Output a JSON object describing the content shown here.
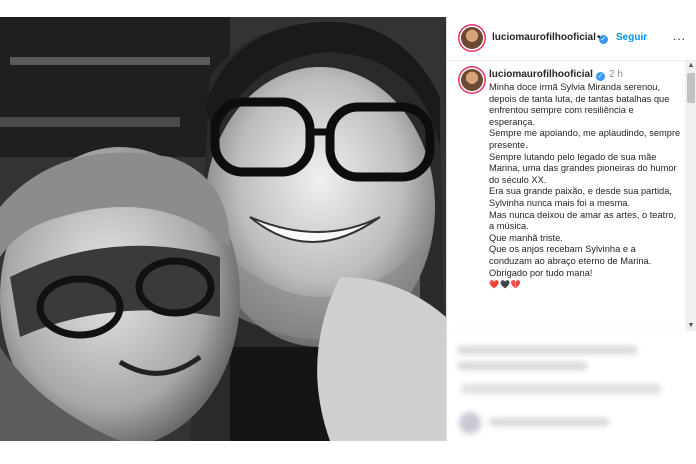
{
  "post": {
    "username": "luciomaurofilhooficial",
    "follow_separator": "•",
    "follow_label": "Seguir",
    "more_label": "...",
    "time": "2 h",
    "verified_icon": "✓",
    "caption_lines": [
      "Minha doce irmã Sylvia Miranda serenou, depois de tanta luta, de tantas batalhas que enfrentou sempre com resiliência e esperança.",
      "Sempre me apoiando, me aplaudindo, sempre presente.",
      "Sempre lutando pelo legado de sua mãe Marina, uma das grandes pioneiras do humor do século XX.",
      "Era sua grande paixão, e desde sua partida, Sylvinha nunca mais foi a mesma.",
      "Mas nunca deixou de amar as artes, o teatro, a música.",
      "Que manhã triste.",
      "Que os anjos recebam Sylvinha e a conduzam ao abraço eterno de Marina.",
      "Obrigado por tudo mana!"
    ],
    "emojis": "❤️🖤💔",
    "scroll_up": "▲",
    "scroll_down": "▼"
  },
  "colors": {
    "link": "#0095f6",
    "verified": "#3897f0",
    "text": "#262626",
    "muted": "#8e8e8e"
  }
}
